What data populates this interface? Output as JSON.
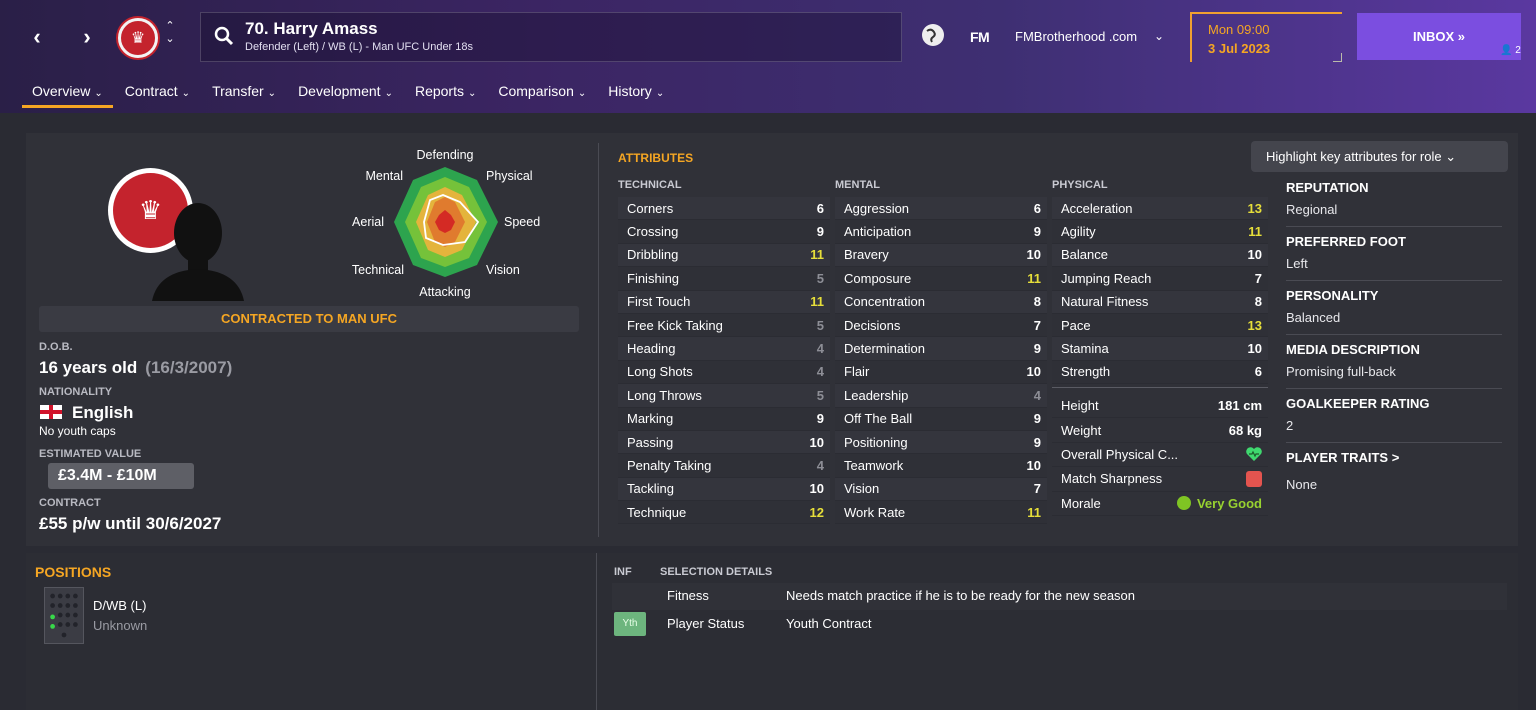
{
  "topbar": {
    "back_icon": "chevron-left-icon",
    "forward_icon": "chevron-right-icon",
    "player_title": "70. Harry Amass",
    "player_subtitle": "Defender (Left) / WB (L) - Man UFC Under 18s",
    "fm_logo": "FM",
    "skin_name": "FMBrotherhood .com",
    "date_day": "Mon 09:00",
    "date_date": "3 Jul 2023",
    "inbox_label": "INBOX »",
    "inbox_count": "2"
  },
  "tabs": [
    {
      "label": "Overview"
    },
    {
      "label": "Contract"
    },
    {
      "label": "Transfer"
    },
    {
      "label": "Development"
    },
    {
      "label": "Reports"
    },
    {
      "label": "Comparison"
    },
    {
      "label": "History"
    }
  ],
  "radar": {
    "labels": {
      "defending": "Defending",
      "physical": "Physical",
      "speed": "Speed",
      "vision": "Vision",
      "attacking": "Attacking",
      "technical": "Technical",
      "aerial": "Aerial",
      "mental": "Mental"
    }
  },
  "profile": {
    "contract_banner": "CONTRACTED TO MAN UFC",
    "dob_label": "D.O.B.",
    "age": "16 years old",
    "dob": "(16/3/2007)",
    "nationality_label": "NATIONALITY",
    "nationality": "English",
    "youth_caps": "No youth caps",
    "value_label": "ESTIMATED VALUE",
    "value": "£3.4M - £10M",
    "contract_label": "CONTRACT",
    "contract": "£55 p/w until 30/6/2027"
  },
  "attributes": {
    "title": "ATTRIBUTES",
    "highlight_button": "Highlight key attributes for role",
    "technical_header": "TECHNICAL",
    "mental_header": "MENTAL",
    "physical_header": "PHYSICAL",
    "technical": [
      {
        "name": "Corners",
        "value": "6"
      },
      {
        "name": "Crossing",
        "value": "9"
      },
      {
        "name": "Dribbling",
        "value": "11"
      },
      {
        "name": "Finishing",
        "value": "5"
      },
      {
        "name": "First Touch",
        "value": "11"
      },
      {
        "name": "Free Kick Taking",
        "value": "5"
      },
      {
        "name": "Heading",
        "value": "4"
      },
      {
        "name": "Long Shots",
        "value": "4"
      },
      {
        "name": "Long Throws",
        "value": "5"
      },
      {
        "name": "Marking",
        "value": "9"
      },
      {
        "name": "Passing",
        "value": "10"
      },
      {
        "name": "Penalty Taking",
        "value": "4"
      },
      {
        "name": "Tackling",
        "value": "10"
      },
      {
        "name": "Technique",
        "value": "12"
      }
    ],
    "mental": [
      {
        "name": "Aggression",
        "value": "6"
      },
      {
        "name": "Anticipation",
        "value": "9"
      },
      {
        "name": "Bravery",
        "value": "10"
      },
      {
        "name": "Composure",
        "value": "11"
      },
      {
        "name": "Concentration",
        "value": "8"
      },
      {
        "name": "Decisions",
        "value": "7"
      },
      {
        "name": "Determination",
        "value": "9"
      },
      {
        "name": "Flair",
        "value": "10"
      },
      {
        "name": "Leadership",
        "value": "4"
      },
      {
        "name": "Off The Ball",
        "value": "9"
      },
      {
        "name": "Positioning",
        "value": "9"
      },
      {
        "name": "Teamwork",
        "value": "10"
      },
      {
        "name": "Vision",
        "value": "7"
      },
      {
        "name": "Work Rate",
        "value": "11"
      }
    ],
    "physical": [
      {
        "name": "Acceleration",
        "value": "13"
      },
      {
        "name": "Agility",
        "value": "11"
      },
      {
        "name": "Balance",
        "value": "10"
      },
      {
        "name": "Jumping Reach",
        "value": "7"
      },
      {
        "name": "Natural Fitness",
        "value": "8"
      },
      {
        "name": "Pace",
        "value": "13"
      },
      {
        "name": "Stamina",
        "value": "10"
      },
      {
        "name": "Strength",
        "value": "6"
      }
    ],
    "physical_extra": {
      "height_label": "Height",
      "height": "181 cm",
      "weight_label": "Weight",
      "weight": "68 kg",
      "condition_label": "Overall Physical C...",
      "condition_icon": "heart-icon",
      "sharpness_label": "Match Sharpness",
      "sharpness_icon": "sharpness-icon",
      "morale_label": "Morale",
      "morale": "Very Good"
    }
  },
  "info": {
    "reputation_label": "REPUTATION",
    "reputation": "Regional",
    "foot_label": "PREFERRED FOOT",
    "foot": "Left",
    "personality_label": "PERSONALITY",
    "personality": "Balanced",
    "media_label": "MEDIA DESCRIPTION",
    "media": "Promising full-back",
    "gk_label": "GOALKEEPER RATING",
    "gk": "2",
    "traits_label": "PLAYER TRAITS >",
    "traits": "None"
  },
  "positions": {
    "title": "POSITIONS",
    "position": "D/WB (L)",
    "familiarity": "Unknown"
  },
  "selection": {
    "inf_header": "INF",
    "details_header": "SELECTION DETAILS",
    "fitness_label": "Fitness",
    "fitness_value": "Needs match practice if he is to be ready for the new season",
    "status_badge": "Yth",
    "status_label": "Player Status",
    "status_value": "Youth Contract"
  },
  "colors": {
    "accent": "#f5a623",
    "inbox": "#7b4ee0",
    "good_attr": "#e6de3a",
    "low_attr": "#8d8e96",
    "club_red": "#c4232d"
  }
}
